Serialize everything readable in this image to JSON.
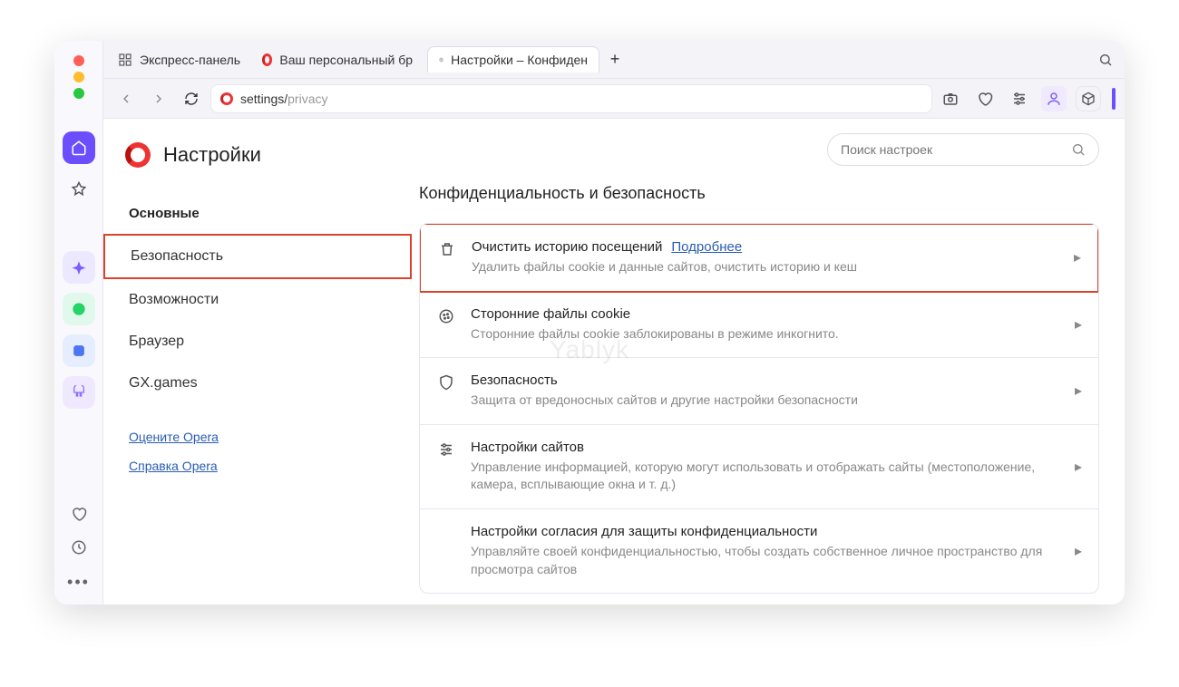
{
  "tabs": {
    "speed_dial": "Экспресс-панель",
    "personal": "Ваш персональный бр",
    "settings": "Настройки – Конфиден"
  },
  "address": {
    "prefix": "settings/",
    "path": "privacy"
  },
  "settings": {
    "title": "Настройки",
    "search_placeholder": "Поиск настроек",
    "sidebar": {
      "heading": "Основные",
      "items": [
        "Безопасность",
        "Возможности",
        "Браузер",
        "GX.games"
      ],
      "links": [
        "Оцените Opera",
        "Справка Opera"
      ]
    },
    "section_title": "Конфиденциальность и безопасность",
    "cards": [
      {
        "title": "Очистить историю посещений",
        "link": "Подробнее",
        "desc": "Удалить файлы cookie и данные сайтов, очистить историю и кеш"
      },
      {
        "title": "Сторонние файлы cookie",
        "desc": "Сторонние файлы cookie заблокированы в режиме инкогнито."
      },
      {
        "title": "Безопасность",
        "desc": "Защита от вредоносных сайтов и другие настройки безопасности"
      },
      {
        "title": "Настройки сайтов",
        "desc": "Управление информацией, которую могут использовать и отображать сайты (местоположение, камера, всплывающие окна и т. д.)"
      },
      {
        "title": "Настройки согласия для защиты конфиденциальности",
        "desc": "Управляйте своей конфиденциальностью, чтобы создать собственное личное пространство для просмотра сайтов"
      }
    ]
  },
  "watermark": "Yablyk"
}
